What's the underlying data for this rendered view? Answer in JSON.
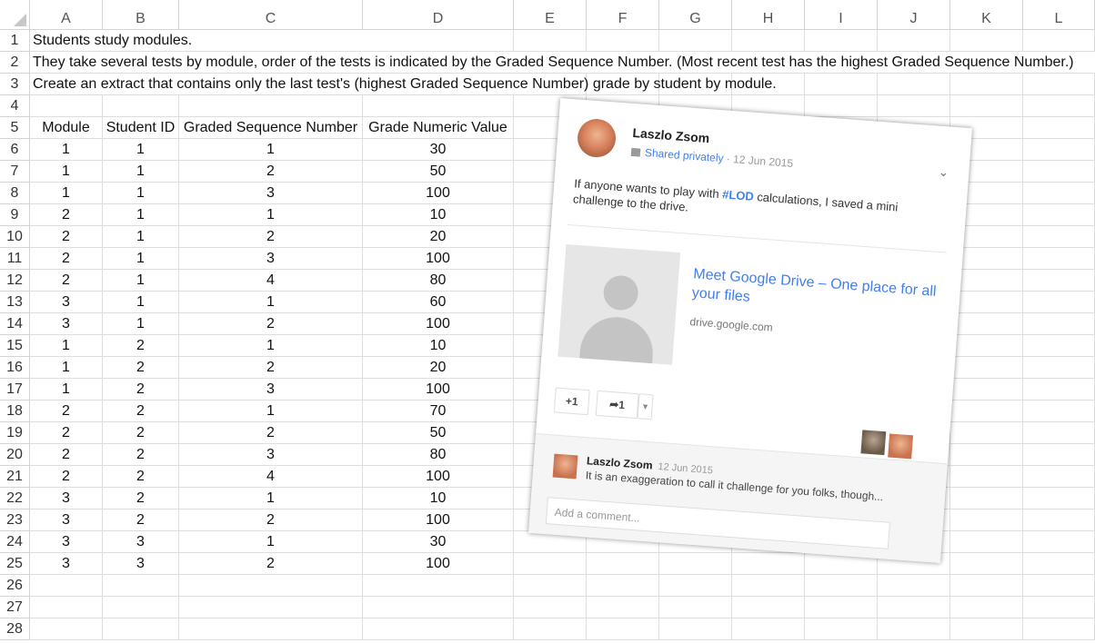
{
  "columns": [
    "A",
    "B",
    "C",
    "D",
    "E",
    "F",
    "G",
    "H",
    "I",
    "J",
    "K",
    "L"
  ],
  "rows": [
    "1",
    "2",
    "3",
    "4",
    "5",
    "6",
    "7",
    "8",
    "9",
    "10",
    "11",
    "12",
    "13",
    "14",
    "15",
    "16",
    "17",
    "18",
    "19",
    "20",
    "21",
    "22",
    "23",
    "24",
    "25",
    "26",
    "27",
    "28"
  ],
  "notes": [
    "Students study modules.",
    "They take several tests by module, order of the tests is indicated by the Graded Sequence Number. (Most recent test has the highest Graded Sequence Number.)",
    "Create an extract that contains only the last test's (highest Graded Sequence Number) grade by student by module."
  ],
  "table": {
    "headers": [
      "Module",
      "Student ID",
      "Graded Sequence Number",
      "Grade Numeric Value"
    ],
    "rows": [
      [
        "1",
        "1",
        "1",
        "30"
      ],
      [
        "1",
        "1",
        "2",
        "50"
      ],
      [
        "1",
        "1",
        "3",
        "100"
      ],
      [
        "2",
        "1",
        "1",
        "10"
      ],
      [
        "2",
        "1",
        "2",
        "20"
      ],
      [
        "2",
        "1",
        "3",
        "100"
      ],
      [
        "2",
        "1",
        "4",
        "80"
      ],
      [
        "3",
        "1",
        "1",
        "60"
      ],
      [
        "3",
        "1",
        "2",
        "100"
      ],
      [
        "1",
        "2",
        "1",
        "10"
      ],
      [
        "1",
        "2",
        "2",
        "20"
      ],
      [
        "1",
        "2",
        "3",
        "100"
      ],
      [
        "2",
        "2",
        "1",
        "70"
      ],
      [
        "2",
        "2",
        "2",
        "50"
      ],
      [
        "2",
        "2",
        "3",
        "80"
      ],
      [
        "2",
        "2",
        "4",
        "100"
      ],
      [
        "3",
        "2",
        "1",
        "10"
      ],
      [
        "3",
        "2",
        "2",
        "100"
      ],
      [
        "3",
        "3",
        "1",
        "30"
      ],
      [
        "3",
        "3",
        "2",
        "100"
      ]
    ]
  },
  "post": {
    "author": "Laszlo Zsom",
    "visibility": "Shared privately",
    "separator": "·",
    "date": "12 Jun 2015",
    "text_before": "If anyone wants to play with ",
    "hashtag": "#LOD",
    "text_after": " calculations, I saved a mini challenge to the drive.",
    "link_title": "Meet Google Drive – One place for all your files",
    "link_domain": "drive.google.com",
    "plus_one": "+1",
    "share_count": "1",
    "comment": {
      "author": "Laszlo Zsom",
      "date": "12 Jun 2015",
      "text": "It is an exaggeration to call it challenge for you folks, though..."
    },
    "comment_placeholder": "Add a comment...",
    "icons": {
      "menu": "chevron-down-icon",
      "share": "share-arrow-icon",
      "lock": "lock-icon"
    }
  }
}
